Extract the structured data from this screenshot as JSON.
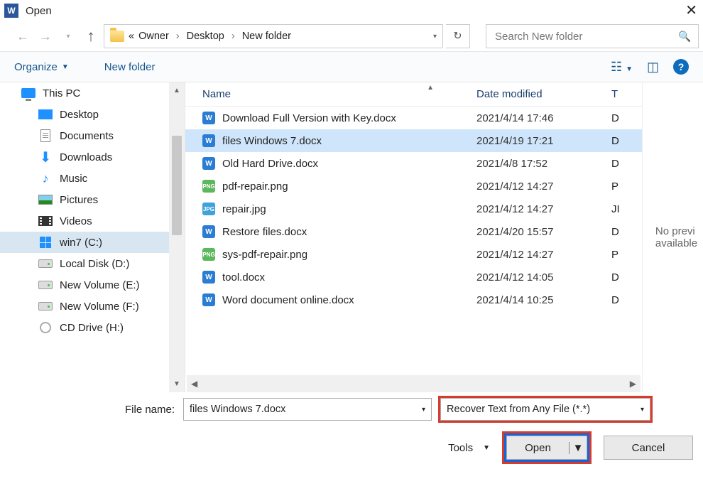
{
  "window": {
    "title": "Open"
  },
  "nav": {
    "breadcrumb_prefix": "«",
    "crumbs": [
      "Owner",
      "Desktop",
      "New folder"
    ],
    "search_placeholder": "Search New folder"
  },
  "toolbar": {
    "organize": "Organize",
    "newfolder": "New folder"
  },
  "sidebar": {
    "items": [
      {
        "label": "This PC",
        "icon": "monitor",
        "indent": false,
        "sel": false
      },
      {
        "label": "Desktop",
        "icon": "desktop",
        "indent": true,
        "sel": false
      },
      {
        "label": "Documents",
        "icon": "doc",
        "indent": true,
        "sel": false
      },
      {
        "label": "Downloads",
        "icon": "down",
        "indent": true,
        "sel": false
      },
      {
        "label": "Music",
        "icon": "music",
        "indent": true,
        "sel": false
      },
      {
        "label": "Pictures",
        "icon": "pic",
        "indent": true,
        "sel": false
      },
      {
        "label": "Videos",
        "icon": "video",
        "indent": true,
        "sel": false
      },
      {
        "label": "win7 (C:)",
        "icon": "win",
        "indent": true,
        "sel": true
      },
      {
        "label": "Local Disk (D:)",
        "icon": "drive",
        "indent": true,
        "sel": false
      },
      {
        "label": "New Volume (E:)",
        "icon": "drive",
        "indent": true,
        "sel": false
      },
      {
        "label": "New Volume (F:)",
        "icon": "drive",
        "indent": true,
        "sel": false
      },
      {
        "label": "CD Drive (H:)",
        "icon": "cd",
        "indent": true,
        "sel": false
      }
    ]
  },
  "filelist": {
    "columns": {
      "name": "Name",
      "date": "Date modified",
      "type": "T"
    },
    "rows": [
      {
        "name": "Download Full Version with Key.docx",
        "date": "2021/4/14 17:46",
        "type": "D",
        "ficon": "docx",
        "sel": false
      },
      {
        "name": "files Windows 7.docx",
        "date": "2021/4/19 17:21",
        "type": "D",
        "ficon": "docx",
        "sel": true
      },
      {
        "name": "Old Hard Drive.docx",
        "date": "2021/4/8 17:52",
        "type": "D",
        "ficon": "docx",
        "sel": false
      },
      {
        "name": "pdf-repair.png",
        "date": "2021/4/12 14:27",
        "type": "P",
        "ficon": "png",
        "sel": false
      },
      {
        "name": "repair.jpg",
        "date": "2021/4/12 14:27",
        "type": "JI",
        "ficon": "jpg",
        "sel": false
      },
      {
        "name": "Restore files.docx",
        "date": "2021/4/20 15:57",
        "type": "D",
        "ficon": "docx",
        "sel": false
      },
      {
        "name": "sys-pdf-repair.png",
        "date": "2021/4/12 14:27",
        "type": "P",
        "ficon": "png",
        "sel": false
      },
      {
        "name": "tool.docx",
        "date": "2021/4/12 14:05",
        "type": "D",
        "ficon": "docx",
        "sel": false
      },
      {
        "name": "Word document online.docx",
        "date": "2021/4/14 10:25",
        "type": "D",
        "ficon": "docx",
        "sel": false
      }
    ]
  },
  "preview": {
    "text": "No previ\navailable"
  },
  "bottom": {
    "fname_label": "File name:",
    "fname_value": "files Windows 7.docx",
    "filter": "Recover Text from Any File (*.*)",
    "tools": "Tools",
    "open": "Open",
    "cancel": "Cancel"
  }
}
